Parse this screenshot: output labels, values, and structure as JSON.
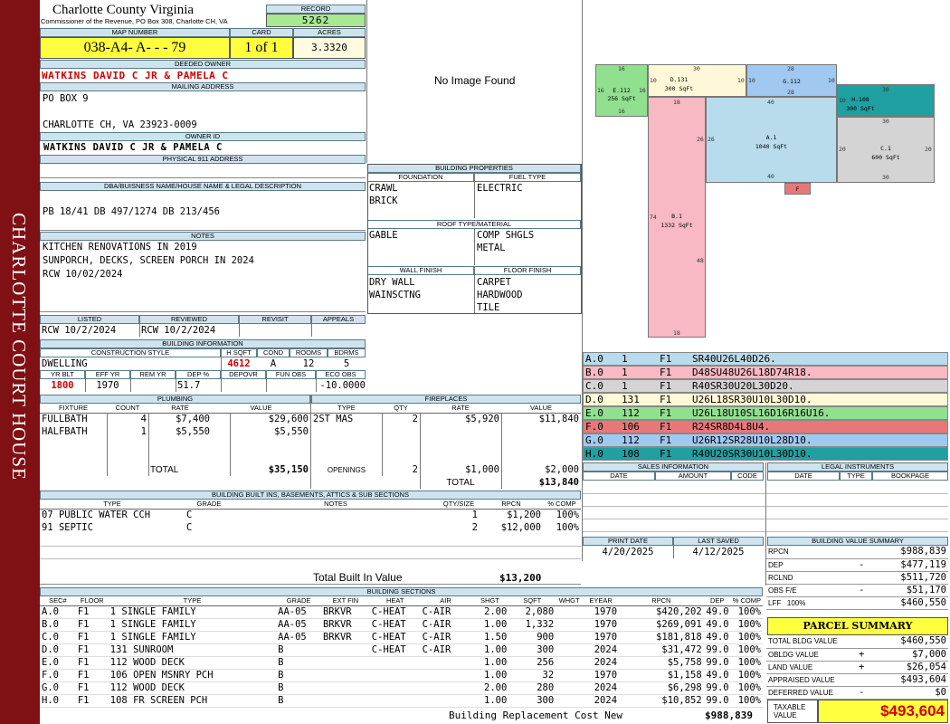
{
  "sidebar": {
    "label": "CHARLOTTE COURT HOUSE"
  },
  "county": {
    "title": "Charlotte County Virginia",
    "subtitle": "Commissioner of the Revenue, PO Box 308, Charlotte CH, VA"
  },
  "record": {
    "label": "RECORD",
    "value": "5262"
  },
  "map": {
    "label": "MAP NUMBER",
    "value": "038-A4- A- - - 79",
    "card_label": "CARD",
    "card_value": "1 of 1",
    "acres_label": "ACRES",
    "acres_value": "3.3320"
  },
  "owner": {
    "label": "DEEDED OWNER",
    "value": "WATKINS DAVID C JR & PAMELA C"
  },
  "mailing": {
    "label": "MAILING ADDRESS",
    "line1": "PO BOX 9",
    "line2": "CHARLOTTE CH, VA 23923-0009"
  },
  "owner_id": {
    "label": "OWNER ID",
    "value": "WATKINS DAVID C JR & PAMELA C"
  },
  "physical": {
    "label": "PHYSICAL 911 ADDRESS",
    "value": ""
  },
  "legal": {
    "label": "DBA/BUISNESS NAME/HOUSE NAME & LEGAL DESCRIPTION",
    "value": "PB 18/41 DB 497/1274 DB 213/456"
  },
  "notes": {
    "label": "NOTES",
    "lines": [
      "KITCHEN RENOVATIONS IN 2019",
      "SUNPORCH, DECKS, SCREEN PORCH IN 2024",
      "RCW 10/02/2024"
    ]
  },
  "image": {
    "placeholder": "No Image Found"
  },
  "props": {
    "label": "BUILDING PROPERTIES",
    "foundation_label": "FOUNDATION",
    "foundation": [
      "CRAWL",
      "BRICK"
    ],
    "fuel_label": "FUEL TYPE",
    "fuel": [
      "ELECTRIC"
    ],
    "roof_label": "ROOF TYPE/MATERIAL",
    "roof_type": [
      "GABLE"
    ],
    "roof_mat": [
      "COMP SHGLS",
      "METAL"
    ],
    "wall_label": "WALL FINISH",
    "wall": [
      "DRY WALL",
      "WAINSCTNG"
    ],
    "floor_label": "FLOOR FINISH",
    "floor": [
      "CARPET",
      "HARDWOOD",
      "TILE"
    ]
  },
  "status": {
    "listed_label": "LISTED",
    "listed": "RCW 10/2/2024",
    "reviewed_label": "REVIEWED",
    "reviewed": "RCW 10/2/2024",
    "revisit_label": "REVISIT",
    "revisit": "",
    "appeals_label": "APPEALS",
    "appeals": ""
  },
  "bldg": {
    "label": "BUILDING INFORMATION",
    "style_label": "CONSTRUCTION STYLE",
    "style": "DWELLING",
    "hsqft_label": "H SQFT",
    "hsqft": "4612",
    "cond_label": "COND",
    "cond": "A",
    "rooms_label": "ROOMS",
    "rooms": "12",
    "bdrms_label": "BDRMS",
    "bdrms": "5",
    "yrblt_label": "YR BLT",
    "yrblt": "1800",
    "effyr_label": "EFF YR",
    "effyr": "1970",
    "remyr_label": "REM YR",
    "remyr": "",
    "dep_label": "DEP %",
    "dep": "51.7",
    "depovr_label": "DEPOVR",
    "depovr": "",
    "funobs_label": "FUN OBS",
    "funobs": "",
    "ecoobs_label": "ECO OBS",
    "ecoobs": "-10.0000"
  },
  "plumbing": {
    "label": "PLUMBING",
    "cols": [
      "FIXTURE",
      "COUNT",
      "RATE",
      "VALUE"
    ],
    "rows": [
      [
        "FULLBATH",
        "4",
        "$7,400",
        "$29,600"
      ],
      [
        "HALFBATH",
        "1",
        "$5,550",
        "$5,550"
      ]
    ],
    "total_label": "TOTAL",
    "total": "$35,150"
  },
  "fireplaces": {
    "label": "FIREPLACES",
    "cols": [
      "TYPE",
      "QTY",
      "RATE",
      "VALUE"
    ],
    "rows": [
      [
        "2ST MAS",
        "2",
        "$5,920",
        "$11,840"
      ]
    ],
    "openings_label": "OPENINGS",
    "openings": [
      "2",
      "$1,000",
      "$2,000"
    ],
    "total_label": "TOTAL",
    "total": "$13,840"
  },
  "builtins": {
    "label": "BUILDING BUILT INS, BASEMENTS, ATTICS & SUB SECTIONS",
    "cols": [
      "TYPE",
      "GRADE",
      "NOTES",
      "QTY/SIZE",
      "RPCN",
      "% COMP"
    ],
    "rows": [
      [
        "07 PUBLIC WATER CCH",
        "C",
        "",
        "1",
        "$1,200",
        "100%"
      ],
      [
        "91 SEPTIC",
        "C",
        "",
        "2",
        "$12,000",
        "100%"
      ]
    ],
    "total_label": "Total Built In Value",
    "total": "$13,200"
  },
  "sketch": {
    "shapes": [
      {
        "id": "E.112",
        "l": "E.112",
        "s": "256 SqFt",
        "color": "#90e090"
      },
      {
        "id": "D.131",
        "l": "D.131",
        "s": "300 SqFt",
        "color": "#fff8d8"
      },
      {
        "id": "G.112",
        "l": "G.112",
        "s": "",
        "color": "#a0c8f0"
      },
      {
        "id": "H.108",
        "l": "H.108",
        "s": "300 SqFt",
        "color": "#20a0a0"
      },
      {
        "id": "A.1",
        "l": "A.1",
        "s": "1040 SqFt",
        "color": "#b8dcec"
      },
      {
        "id": "C.1",
        "l": "C.1",
        "s": "600 SqFt",
        "color": "#d4d4d4"
      },
      {
        "id": "B.1",
        "l": "B.1",
        "s": "1332 SqFt",
        "color": "#f8b8c4"
      },
      {
        "id": "F",
        "l": "F",
        "s": "",
        "color": "#e87878"
      }
    ],
    "dims": [
      "16",
      "16",
      "16",
      "16",
      "10",
      "30",
      "10",
      "10",
      "28",
      "28",
      "10",
      "10",
      "30",
      "30",
      "18",
      "26",
      "26",
      "40",
      "40",
      "74",
      "48",
      "18",
      "20",
      "20",
      "30",
      "30"
    ]
  },
  "segments": [
    {
      "a": "A.0",
      "b": "1",
      "c": "F1",
      "d": "SR40U26L40D26.",
      "color": "#b8dcec"
    },
    {
      "a": "B.0",
      "b": "1",
      "c": "F1",
      "d": "D48SU48U26L18D74R18.",
      "color": "#f8b8c4"
    },
    {
      "a": "C.0",
      "b": "1",
      "c": "F1",
      "d": "R40SR30U20L30D20.",
      "color": "#d4d4d4"
    },
    {
      "a": "D.0",
      "b": "131",
      "c": "F1",
      "d": "U26L18SR30U10L30D10.",
      "color": "#fff8d8"
    },
    {
      "a": "E.0",
      "b": "112",
      "c": "F1",
      "d": "U26L18U10SL16D16R16U16.",
      "color": "#90e090"
    },
    {
      "a": "F.0",
      "b": "106",
      "c": "F1",
      "d": "R24SR8D4L8U4.",
      "color": "#e87878"
    },
    {
      "a": "G.0",
      "b": "112",
      "c": "F1",
      "d": "U26R12SR28U10L28D10.",
      "color": "#a0c8f0"
    },
    {
      "a": "H.0",
      "b": "108",
      "c": "F1",
      "d": "R40U20SR30U10L30D10.",
      "color": "#20a0a0"
    }
  ],
  "sales": {
    "label": "SALES INFORMATION",
    "cols": [
      "DATE",
      "AMOUNT",
      "CODE"
    ]
  },
  "instruments": {
    "label": "LEGAL INSTRUMENTS",
    "cols": [
      "DATE",
      "TYPE",
      "BOOKPAGE"
    ]
  },
  "print": {
    "label": "PRINT DATE",
    "value": "4/20/2025",
    "saved_label": "LAST SAVED",
    "saved": "4/12/2025"
  },
  "bvs": {
    "label": "BUILDING VALUE SUMMARY",
    "rows": [
      [
        "RPCN",
        "",
        "$988,839"
      ],
      [
        "DEP",
        "-",
        "$477,119"
      ],
      [
        "RCLND",
        "",
        "$511,720"
      ],
      [
        "OBS F/E",
        "-",
        "$51,170"
      ],
      [
        "LFF   100%",
        "",
        "$460,550"
      ]
    ]
  },
  "parcel": {
    "label": "PARCEL SUMMARY",
    "rows": [
      [
        "TOTAL BLDG VALUE",
        "",
        "$460,550"
      ],
      [
        "OBLDG VALUE",
        "+",
        "$7,000"
      ],
      [
        "LAND VALUE",
        "+",
        "$26,054"
      ],
      [
        "APPRAISED VALUE",
        "",
        "$493,604"
      ],
      [
        "DEFERRED VALUE",
        "-",
        "$0"
      ]
    ],
    "taxable_label": "TAXABLE VALUE",
    "taxable": "$493,604"
  },
  "sections": {
    "label": "BUILDING SECTIONS",
    "cols": [
      "SEC#",
      "FLOOR",
      "TYPE",
      "GRADE",
      "EXT FIN",
      "HEAT",
      "AIR",
      "SHGT",
      "SQFT",
      "WHGT",
      "EYEAR",
      "RPCN",
      "DEP",
      "% COMP"
    ],
    "rows": [
      [
        "A.0",
        "F1",
        "1 SINGLE FAMILY",
        "AA-05",
        "BRKVR",
        "C-HEAT",
        "C-AIR",
        "2.00",
        "2,080",
        "",
        "1970",
        "$420,202",
        "49.0",
        "100%"
      ],
      [
        "B.0",
        "F1",
        "1 SINGLE FAMILY",
        "AA-05",
        "BRKVR",
        "C-HEAT",
        "C-AIR",
        "1.00",
        "1,332",
        "",
        "1970",
        "$269,091",
        "49.0",
        "100%"
      ],
      [
        "C.0",
        "F1",
        "1 SINGLE FAMILY",
        "AA-05",
        "BRKVR",
        "C-HEAT",
        "C-AIR",
        "1.50",
        "900",
        "",
        "1970",
        "$181,818",
        "49.0",
        "100%"
      ],
      [
        "D.0",
        "F1",
        "131 SUNROOM",
        "B",
        "",
        "C-HEAT",
        "C-AIR",
        "1.00",
        "300",
        "",
        "2024",
        "$31,472",
        "99.0",
        "100%"
      ],
      [
        "E.0",
        "F1",
        "112 WOOD DECK",
        "B",
        "",
        "",
        "",
        "1.00",
        "256",
        "",
        "2024",
        "$5,758",
        "99.0",
        "100%"
      ],
      [
        "F.0",
        "F1",
        "106 OPEN MSNRY PCH",
        "B",
        "",
        "",
        "",
        "1.00",
        "32",
        "",
        "1970",
        "$1,158",
        "49.0",
        "100%"
      ],
      [
        "G.0",
        "F1",
        "112 WOOD DECK",
        "B",
        "",
        "",
        "",
        "2.00",
        "280",
        "",
        "2024",
        "$6,298",
        "99.0",
        "100%"
      ],
      [
        "H.0",
        "F1",
        "108 FR SCREEN PCH",
        "B",
        "",
        "",
        "",
        "1.00",
        "300",
        "",
        "2024",
        "$10,852",
        "99.0",
        "100%"
      ]
    ],
    "total_label": "Building Replacement Cost New",
    "total": "$988,839"
  }
}
